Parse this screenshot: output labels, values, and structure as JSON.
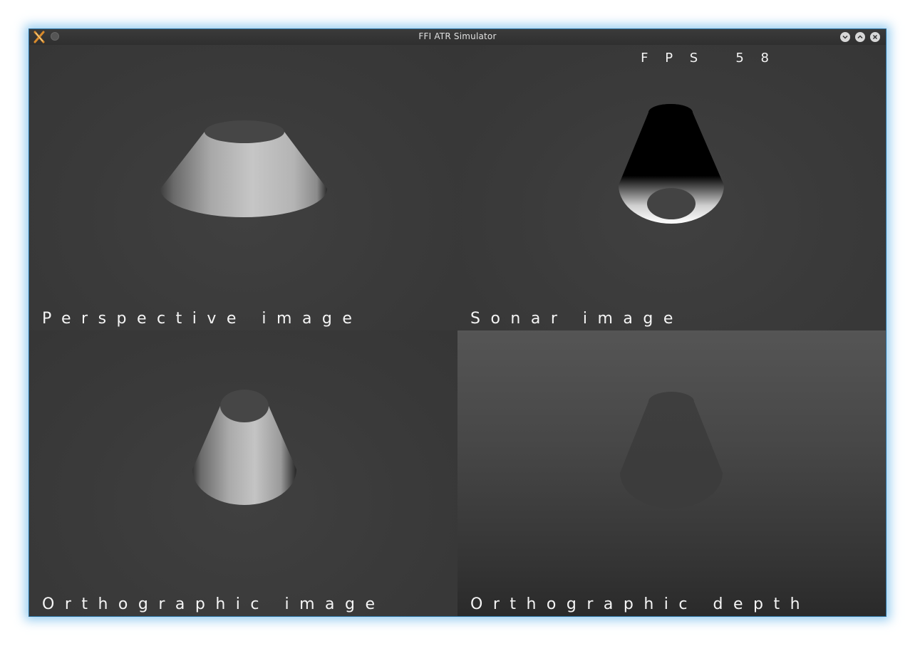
{
  "window": {
    "title": "FFI ATR Simulator"
  },
  "titlebar_icons": {
    "app": "app-icon",
    "menu": "window-menu-icon",
    "minimize": "minimize-icon",
    "maximize": "maximize-icon",
    "close": "close-icon"
  },
  "overlay": {
    "fps": "F P S   5 8"
  },
  "panes": [
    {
      "id": "perspective",
      "label": "Perspective image"
    },
    {
      "id": "sonar",
      "label": "Sonar image"
    },
    {
      "id": "orthographic",
      "label": "Orthographic image"
    },
    {
      "id": "depth",
      "label": "Orthographic depth"
    }
  ],
  "colors": {
    "window_glow": "#78bee8",
    "background": "#3a3a3a",
    "label_text": "#f5f5f5"
  }
}
